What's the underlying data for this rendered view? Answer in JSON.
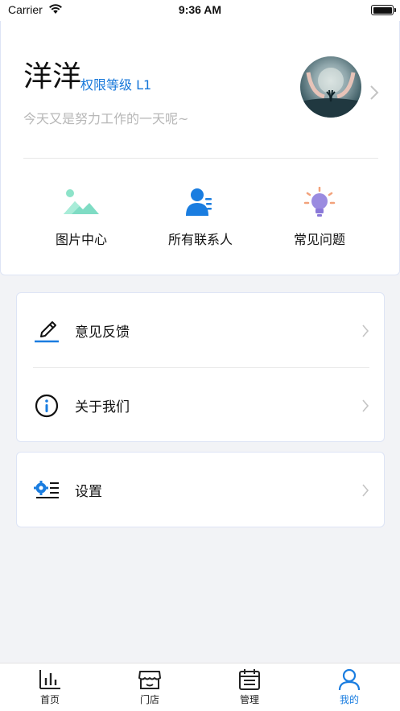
{
  "status_bar": {
    "carrier": "Carrier",
    "time": "9:36 AM"
  },
  "profile": {
    "name": "洋洋",
    "level": "权限等级 L1",
    "motto": "今天又是努力工作的一天呢~"
  },
  "quick_actions": [
    {
      "label": "图片中心",
      "icon": "image-icon"
    },
    {
      "label": "所有联系人",
      "icon": "contacts-icon"
    },
    {
      "label": "常见问题",
      "icon": "lightbulb-icon"
    }
  ],
  "menu": {
    "feedback": "意见反馈",
    "about": "关于我们",
    "settings": "设置"
  },
  "tab_bar": {
    "items": [
      {
        "label": "首页",
        "icon": "bar-chart-icon"
      },
      {
        "label": "门店",
        "icon": "store-icon"
      },
      {
        "label": "管理",
        "icon": "calendar-list-icon"
      },
      {
        "label": "我的",
        "icon": "person-icon"
      }
    ],
    "active_index": 3
  },
  "colors": {
    "accent": "#1a7de0",
    "level_text": "#1677d9",
    "motto_text": "#b7b7b7",
    "background": "#f2f3f6"
  }
}
